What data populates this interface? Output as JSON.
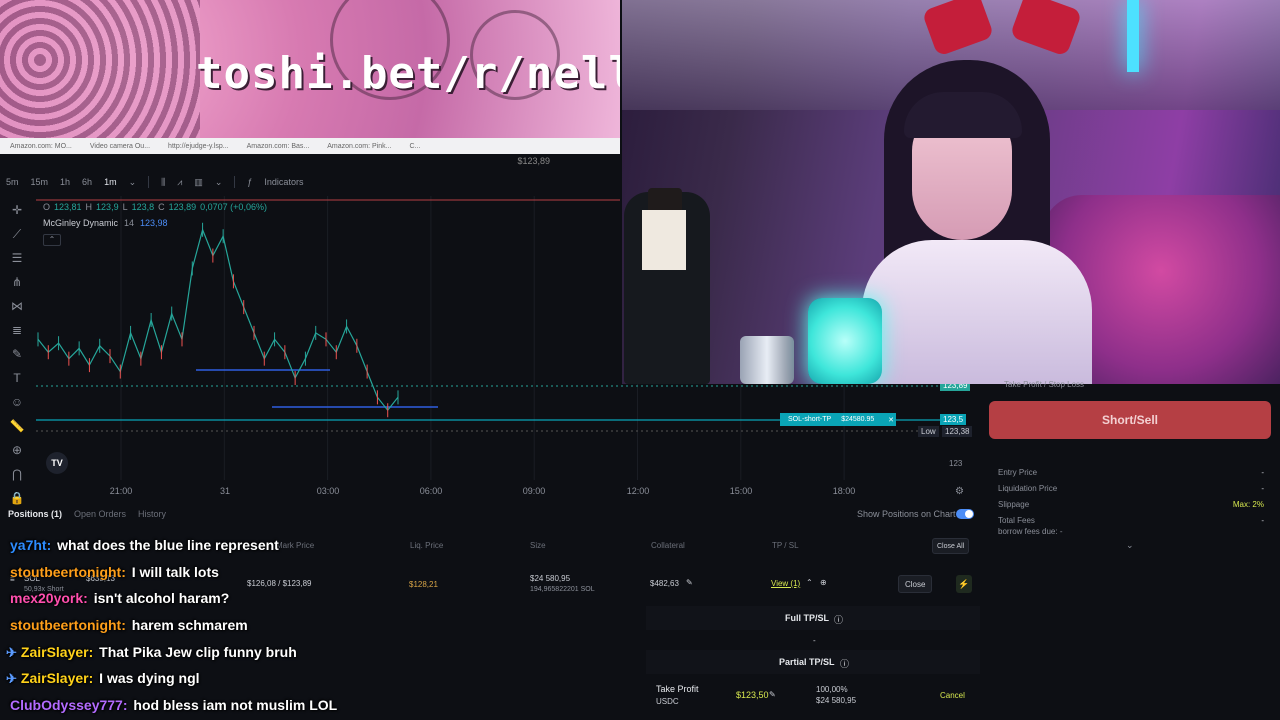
{
  "banner": {
    "text": "toshi.bet/r/nelli"
  },
  "bookmarks": [
    "Amazon.com: MO...",
    "Video camera Ou...",
    "http://ejudge-y.lsp...",
    "Amazon.com: Bas...",
    "Amazon.com: Pink...",
    "C..."
  ],
  "chart_header": {
    "price": "$123,89"
  },
  "timeframes": [
    "5m",
    "15m",
    "1h",
    "6h",
    "1m"
  ],
  "active_timeframe": "1m",
  "indicators_label": "Indicators",
  "ohlc": {
    "o_label": "O",
    "o": "123,81",
    "h_label": "H",
    "h": "123,9",
    "l_label": "L",
    "l": "123,8",
    "c_label": "C",
    "c": "123,89",
    "change": "0,0707 (+0,06%)"
  },
  "indicator": {
    "name": "McGinley Dynamic",
    "period": "14",
    "value": "123,98"
  },
  "chart_data": {
    "type": "line",
    "title": "",
    "x_ticks": [
      "21:00",
      "31",
      "03:00",
      "06:00",
      "09:00",
      "12:00",
      "15:00",
      "18:00"
    ],
    "y_labels": {
      "current": "123,89",
      "tp_price": "123,5",
      "low": "123,38",
      "level": "123"
    },
    "low_label": "Low",
    "series": [
      {
        "values": [
          124.05,
          123.95,
          124.02,
          123.9,
          123.98,
          123.85,
          124.0,
          123.92,
          123.8,
          124.1,
          123.9,
          124.2,
          123.95,
          124.25,
          124.05,
          124.6,
          124.9,
          124.7,
          124.85,
          124.5,
          124.3,
          124.1,
          123.9,
          124.05,
          123.95,
          123.75,
          123.9,
          124.1,
          124.05,
          123.95,
          124.15,
          124.0,
          123.8,
          123.6,
          123.5,
          123.6
        ]
      }
    ],
    "take_profit_label": "SOL-short-TP",
    "take_profit_value": "$24580.95"
  },
  "order_panel": {
    "tpsl_header": "Take Profit / Stop Loss",
    "short_button": "Short/Sell",
    "entry_price_label": "Entry Price",
    "entry_price": "-",
    "liq_label": "Liquidation Price",
    "liq": "-",
    "slippage_label": "Slippage",
    "slippage": "Max: 2%",
    "fees_label": "Total Fees",
    "fees": "-",
    "borrow_label": "borrow fees due: -"
  },
  "positions": {
    "tabs": [
      "Positions (1)",
      "Open Orders",
      "History"
    ],
    "show_on_chart": "Show Positions on Chart",
    "close_all": "Close All",
    "columns": {
      "mark": "Mark Price",
      "liq": "Liq. Price",
      "size": "Size",
      "collateral": "Collateral",
      "tpsl": "TP / SL"
    },
    "row": {
      "market": "SOL",
      "side": "50,93x Short",
      "pnl": "$633,13",
      "entry_mark": "$126,08 / $123,89",
      "liq_price": "$128,21",
      "size_usd": "$24 580,95",
      "size_sol": "194,965822201 SOL",
      "collateral": "$482,63",
      "view": "View (1)",
      "close": "Close"
    },
    "full_tpsl": "Full TP/SL",
    "full_tpsl_value": "-",
    "partial_tpsl": "Partial TP/SL",
    "tp_row": {
      "label": "Take Profit",
      "token": "USDC",
      "price": "$123,50",
      "pct": "100,00%",
      "usd": "$24 580,95",
      "cancel": "Cancel"
    }
  },
  "chat": [
    {
      "user": "ya7ht:",
      "color": "#2d8cff",
      "badge": "",
      "msg": "what does the blue line represent"
    },
    {
      "user": "stoutbeertonight:",
      "color": "#ff9f1a",
      "badge": "",
      "msg": "I will talk lots"
    },
    {
      "user": "mex20york:",
      "color": "#ff4fae",
      "badge": "",
      "msg": "isn't alcohol haram?"
    },
    {
      "user": "stoutbeertonight:",
      "color": "#ff9f1a",
      "badge": "",
      "msg": "harem schmarem"
    },
    {
      "user": "ZairSlayer:",
      "color": "#ffd21a",
      "badge": "✈",
      "msg": "That Pika Jew clip funny bruh"
    },
    {
      "user": "ZairSlayer:",
      "color": "#ffd21a",
      "badge": "✈",
      "msg": "I was dying ngl"
    },
    {
      "user": "ClubOdyssey777:",
      "color": "#b36bff",
      "badge": "",
      "msg": "hod bless iam not muslim LOL"
    }
  ]
}
